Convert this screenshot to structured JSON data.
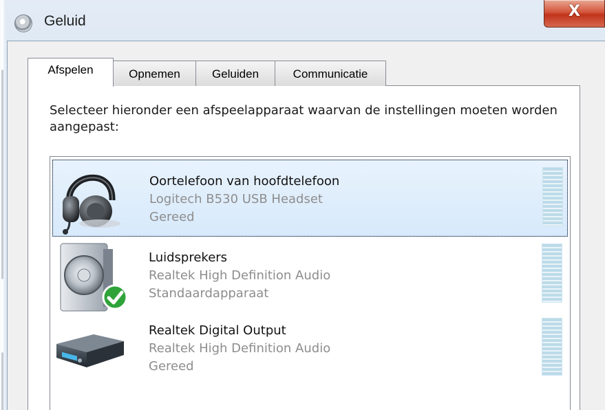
{
  "window": {
    "title": "Geluid",
    "title_icon": "speaker-cog-icon",
    "close_icon": "close-icon",
    "close_glyph": "X"
  },
  "tabs": [
    {
      "label": "Afspelen",
      "active": true
    },
    {
      "label": "Opnemen",
      "active": false
    },
    {
      "label": "Geluiden",
      "active": false
    },
    {
      "label": "Communicatie",
      "active": false
    }
  ],
  "instruction": "Selecteer hieronder een afspeelapparaat waarvan de instellingen moeten worden aangepast:",
  "devices": [
    {
      "name": "Oortelefoon van hoofdtelefoon",
      "driver": "Logitech B530 USB Headset",
      "status": "Gereed",
      "icon": "headset-icon",
      "selected": true
    },
    {
      "name": "Luidsprekers",
      "driver": "Realtek High Definition Audio",
      "status": "Standaardapparaat",
      "icon": "speaker-icon",
      "badge_icon": "default-checkmark-icon",
      "selected": false
    },
    {
      "name": "Realtek Digital Output",
      "driver": "Realtek High Definition Audio",
      "status": "Gereed",
      "icon": "digital-receiver-icon",
      "selected": false
    }
  ],
  "colors": {
    "selection": "#d7e9fb",
    "meter": "#bcdbe9",
    "close_button": "#c0341b",
    "check_badge": "#2fa33a"
  }
}
